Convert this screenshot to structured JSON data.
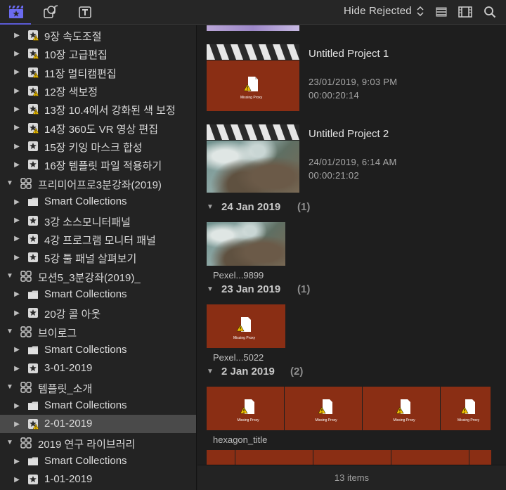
{
  "toolbar": {
    "filter_label": "Hide Rejected",
    "icons": [
      "libraries-clapper-icon",
      "photos-audio-icon",
      "titles-generators-icon",
      "filmstrip-list-toggle-icon",
      "clip-appearance-icon",
      "search-icon"
    ],
    "accent_color": "#5b5bd6"
  },
  "sidebar": {
    "rows": [
      {
        "label": "9장 속도조절",
        "type": "event-warning"
      },
      {
        "label": "10장 고급편집",
        "type": "event-warning"
      },
      {
        "label": "11장 멀티캠편집",
        "type": "event-warning"
      },
      {
        "label": "12장 색보정",
        "type": "event-warning"
      },
      {
        "label": "13장 10.4에서 강화된 색 보정",
        "type": "event-warning"
      },
      {
        "label": "14장 360도 VR 영상 편집",
        "type": "event-warning"
      },
      {
        "label": "15장 키잉 마스크 합성",
        "type": "event"
      },
      {
        "label": "16장 템플릿 파일 적용하기",
        "type": "event"
      },
      {
        "label": "프리미어프로3분강좌(2019)",
        "type": "library"
      },
      {
        "label": "Smart Collections",
        "type": "folder"
      },
      {
        "label": "3강 소스모니터패널",
        "type": "event"
      },
      {
        "label": "4강 프로그램 모니터 패널",
        "type": "event"
      },
      {
        "label": "5강 툴 패널 살펴보기",
        "type": "event"
      },
      {
        "label": "모션5_3분강좌(2019)_",
        "type": "library"
      },
      {
        "label": "Smart Collections",
        "type": "folder"
      },
      {
        "label": "20강 콜 아웃",
        "type": "event"
      },
      {
        "label": "브이로그",
        "type": "library"
      },
      {
        "label": "Smart Collections",
        "type": "folder"
      },
      {
        "label": "3-01-2019",
        "type": "event"
      },
      {
        "label": "템플릿_소개",
        "type": "library"
      },
      {
        "label": "Smart Collections",
        "type": "folder"
      },
      {
        "label": "2-01-2019",
        "type": "event-warning",
        "selected": true
      },
      {
        "label": "2019 연구 라이브러리",
        "type": "library"
      },
      {
        "label": "Smart Collections",
        "type": "folder"
      },
      {
        "label": "1-01-2019",
        "type": "event"
      }
    ]
  },
  "browser": {
    "missing_proxy_label": "Missing Proxy",
    "projects": [
      {
        "title": "Untitled Project 1",
        "date": "23/01/2019, 9:03 PM",
        "duration": "00:00:20:14",
        "thumb": "proxy"
      },
      {
        "title": "Untitled Project 2",
        "date": "24/01/2019, 6:14 AM",
        "duration": "00:00:21:02",
        "thumb": "aerial"
      }
    ],
    "sections": [
      {
        "date": "24 Jan 2019",
        "count": "(1)",
        "clip": "Pexel...9899"
      },
      {
        "date": "23 Jan 2019",
        "count": "(1)",
        "clip": "Pexel...5022"
      },
      {
        "date": "2 Jan 2019",
        "count": "(2)",
        "clip": "hexagon_title"
      }
    ]
  },
  "status": {
    "text": "13 items"
  }
}
